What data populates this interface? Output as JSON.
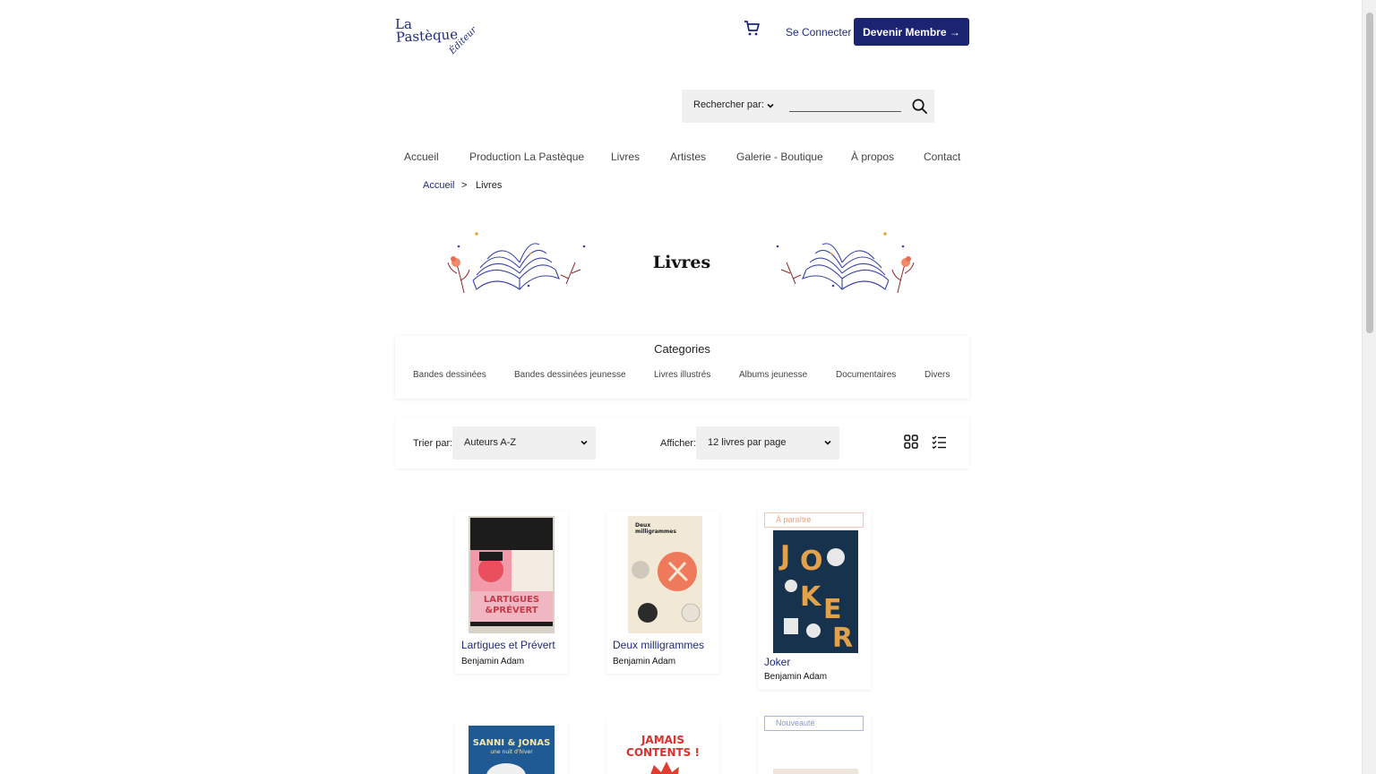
{
  "header": {
    "logo": {
      "line1": "La",
      "line2": "Pastèque",
      "line3": "Éditeur"
    },
    "login_label": "Se Connecter",
    "member_button_label": "Devenir Membre →"
  },
  "search": {
    "by_label": "Rechercher par:",
    "value": ""
  },
  "nav": {
    "items": [
      "Accueil",
      "Production La Pastèque",
      "Livres",
      "Artistes",
      "Galerie - Boutique",
      "À propos",
      "Contact"
    ]
  },
  "breadcrumb": {
    "home": "Accueil",
    "separator": ">",
    "current": "Livres"
  },
  "page": {
    "title": "Livres"
  },
  "categories": {
    "title": "Categories",
    "items": [
      "Bandes dessinées",
      "Bandes dessinées jeunesse",
      "Livres illustrés",
      "Albums jeunesse",
      "Documentaires",
      "Divers"
    ]
  },
  "sort": {
    "sort_label": "Trier par:",
    "sort_value": "Auteurs A-Z",
    "show_label": "Afficher:",
    "show_value": "12 livres par page"
  },
  "books": [
    {
      "title": "Lartigues et Prévert",
      "author": "Benjamin Adam",
      "badge": "",
      "cover_text": "LARTIGUES PRÉVERT"
    },
    {
      "title": "Deux milligrammes",
      "author": "Benjamin Adam",
      "badge": "",
      "cover_text": "Deux milligrammes"
    },
    {
      "title": "Joker",
      "author": "Benjamin Adam",
      "badge": "À paraître",
      "cover_text": "JOKER"
    },
    {
      "title": "",
      "author": "",
      "badge": "",
      "cover_text": "SANNI & JONAS"
    },
    {
      "title": "",
      "author": "",
      "badge": "",
      "cover_text": "JAMAIS CONTENTS !"
    },
    {
      "title": "",
      "author": "",
      "badge": "Nouveauté",
      "cover_text": ""
    }
  ],
  "colors": {
    "brand_navy": "#1a2470",
    "link_blue": "#1f2a7a",
    "badge_orange": "#f0a37d",
    "badge_blue": "#8a95d8"
  }
}
